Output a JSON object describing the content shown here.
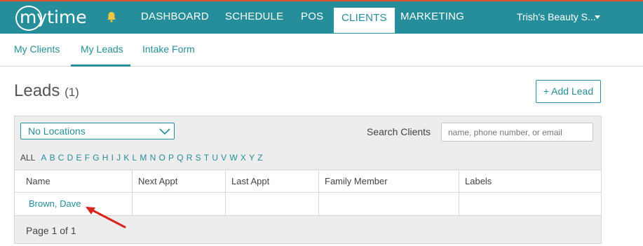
{
  "brand": {
    "logo_text": "mytime",
    "accent_color": "#258e9a",
    "top_border_color": "#e2532b"
  },
  "topnav": {
    "items": [
      {
        "label": "DASHBOARD"
      },
      {
        "label": "SCHEDULE"
      },
      {
        "label": "POS"
      },
      {
        "label": "CLIENTS"
      },
      {
        "label": "MARKETING"
      }
    ],
    "active": "CLIENTS",
    "account_label": "Trish's Beauty S...",
    "bell_icon": "bell-icon"
  },
  "subnav": {
    "tabs": [
      {
        "label": "My Clients"
      },
      {
        "label": "My Leads"
      },
      {
        "label": "Intake Form"
      }
    ],
    "active": "My Leads"
  },
  "page": {
    "title": "Leads",
    "count": "(1)",
    "add_button": "+ Add Lead"
  },
  "filters": {
    "location_value": "No Locations",
    "search_label": "Search Clients",
    "search_placeholder": "name, phone number, or email",
    "all_label": "ALL",
    "letters": [
      "A",
      "B",
      "C",
      "D",
      "E",
      "F",
      "G",
      "H",
      "I",
      "J",
      "K",
      "L",
      "M",
      "N",
      "O",
      "P",
      "Q",
      "R",
      "S",
      "T",
      "U",
      "V",
      "W",
      "X",
      "Y",
      "Z"
    ]
  },
  "table": {
    "columns": [
      "Name",
      "Next Appt",
      "Last Appt",
      "Family Member",
      "Labels"
    ],
    "rows": [
      {
        "name": "Brown, Dave",
        "next_appt": "",
        "last_appt": "",
        "family_member": "",
        "labels": ""
      }
    ],
    "pagination": "Page 1 of 1"
  }
}
